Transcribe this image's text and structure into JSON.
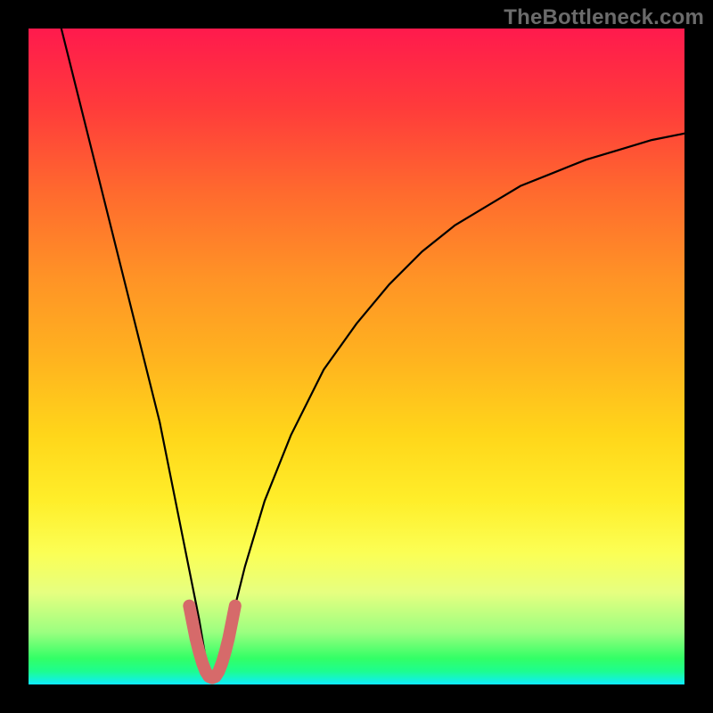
{
  "watermark": "TheBottleneck.com",
  "chart_data": {
    "type": "line",
    "title": "",
    "xlabel": "",
    "ylabel": "",
    "xlim": [
      0,
      100
    ],
    "ylim": [
      0,
      100
    ],
    "minimum_x": 28,
    "series": [
      {
        "name": "bottleneck-curve",
        "x": [
          5,
          8,
          11,
          14,
          17,
          20,
          22,
          24,
          26,
          27,
          28,
          29,
          31,
          33,
          36,
          40,
          45,
          50,
          55,
          60,
          65,
          70,
          75,
          80,
          85,
          90,
          95,
          100
        ],
        "y": [
          100,
          88,
          76,
          64,
          52,
          40,
          30,
          20,
          10,
          4,
          1,
          4,
          10,
          18,
          28,
          38,
          48,
          55,
          61,
          66,
          70,
          73,
          76,
          78,
          80,
          81.5,
          83,
          84
        ]
      },
      {
        "name": "highlight-u",
        "x": [
          24.5,
          25,
          25.5,
          26,
          26.5,
          27,
          27.5,
          28,
          28.5,
          29,
          29.5,
          30,
          30.5,
          31,
          31.5
        ],
        "y": [
          12,
          9.5,
          7,
          5,
          3.3,
          2,
          1.2,
          1,
          1.2,
          2,
          3.3,
          5,
          7,
          9.5,
          12
        ]
      }
    ],
    "colors": {
      "curve": "#000000",
      "highlight": "#d66a6a"
    }
  }
}
